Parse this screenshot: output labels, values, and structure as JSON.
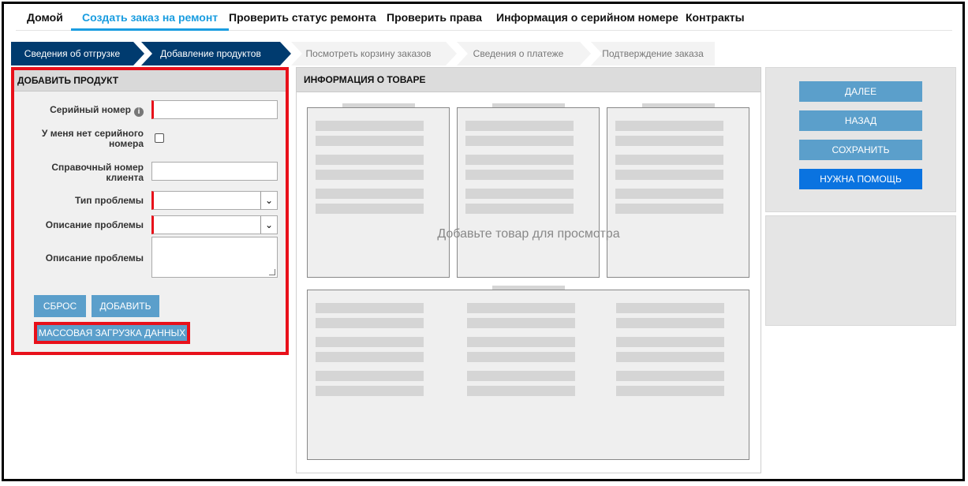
{
  "topnav": {
    "items": [
      "Домой",
      "Создать заказ на ремонт",
      "Проверить статус ремонта",
      "Проверить права",
      "Информация о серийном номере",
      "Контракты"
    ],
    "active_index": 1
  },
  "steps": [
    "Сведения об отгрузке",
    "Добавление продуктов",
    "Посмотреть корзину заказов",
    "Сведения о платеже",
    "Подтверждение заказа"
  ],
  "add_product": {
    "title": "ДОБАВИТЬ ПРОДУКТ",
    "serial_label": "Серийный номер",
    "no_serial_label": "У меня нет серийного номера",
    "customer_ref_label": "Справочный номер клиента",
    "problem_type_label": "Тип проблемы",
    "problem_desc_select_label": "Описание проблемы",
    "problem_desc_text_label": "Описание проблемы",
    "reset_button": "СБРОС",
    "add_button": "ДОБАВИТЬ",
    "bulk_upload_button": "МАССОВАЯ ЗАГРУЗКА ДАННЫХ"
  },
  "product_info": {
    "title": "ИНФОРМАЦИЯ О ТОВАРЕ",
    "empty_message": "Добавьте товар для просмотра"
  },
  "actions": {
    "next": "ДАЛЕЕ",
    "back": "НАЗАД",
    "save": "СОХРАНИТЬ",
    "help": "НУЖНА ПОМОЩЬ"
  },
  "colors": {
    "accent": "#1a9de0",
    "step_done": "#003b6f",
    "button": "#5b9fcb",
    "help_button": "#0a73e0",
    "highlight": "#e8101a"
  }
}
